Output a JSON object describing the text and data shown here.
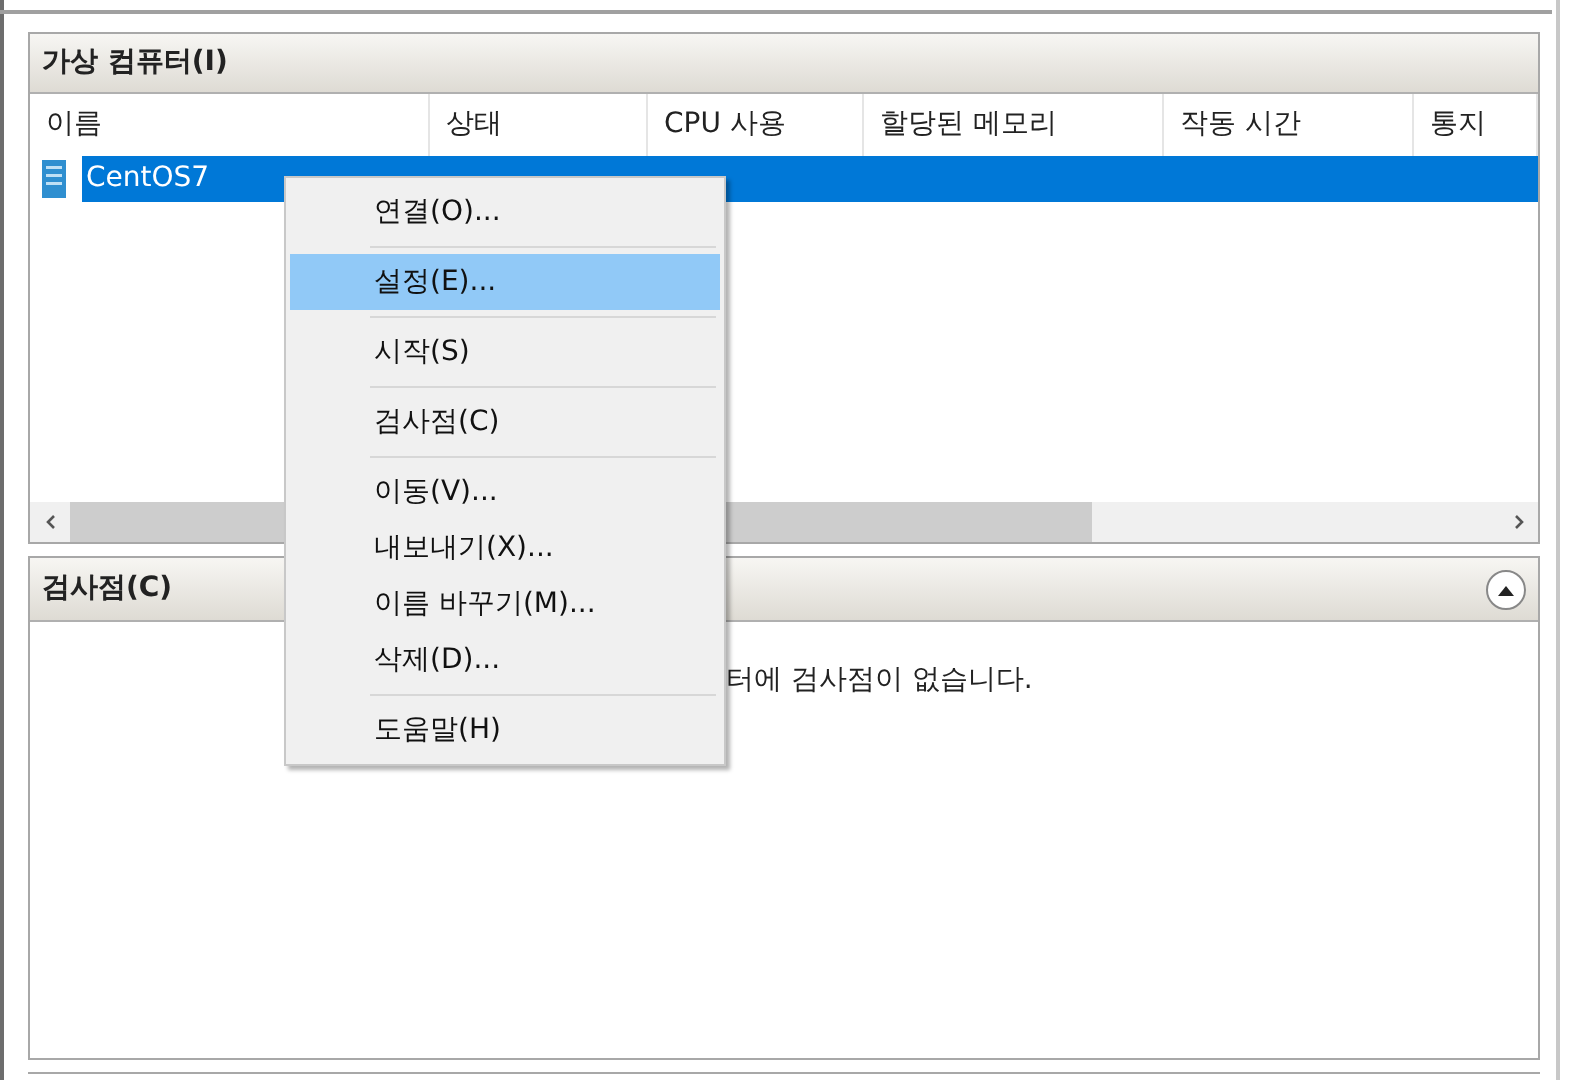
{
  "vm_panel": {
    "title": "가상 컴퓨터(I)",
    "columns": [
      "이름",
      "상태",
      "CPU 사용",
      "할당된 메모리",
      "작동 시간",
      "통지"
    ],
    "rows": [
      {
        "name": "CentOS7",
        "selected": true
      }
    ]
  },
  "checkpoint_panel": {
    "title": "검사점(C)",
    "message": "터에 검사점이 없습니다."
  },
  "context_menu": [
    {
      "kind": "item",
      "label": "연결(O)...",
      "selected": false
    },
    {
      "kind": "separator"
    },
    {
      "kind": "item",
      "label": "설정(E)...",
      "selected": true
    },
    {
      "kind": "separator"
    },
    {
      "kind": "item",
      "label": "시작(S)",
      "selected": false
    },
    {
      "kind": "separator"
    },
    {
      "kind": "item",
      "label": "검사점(C)",
      "selected": false
    },
    {
      "kind": "separator"
    },
    {
      "kind": "item",
      "label": "이동(V)...",
      "selected": false
    },
    {
      "kind": "item",
      "label": "내보내기(X)...",
      "selected": false
    },
    {
      "kind": "item",
      "label": "이름 바꾸기(M)...",
      "selected": false
    },
    {
      "kind": "item",
      "label": "삭제(D)...",
      "selected": false
    },
    {
      "kind": "separator"
    },
    {
      "kind": "item",
      "label": "도움말(H)",
      "selected": false
    }
  ]
}
